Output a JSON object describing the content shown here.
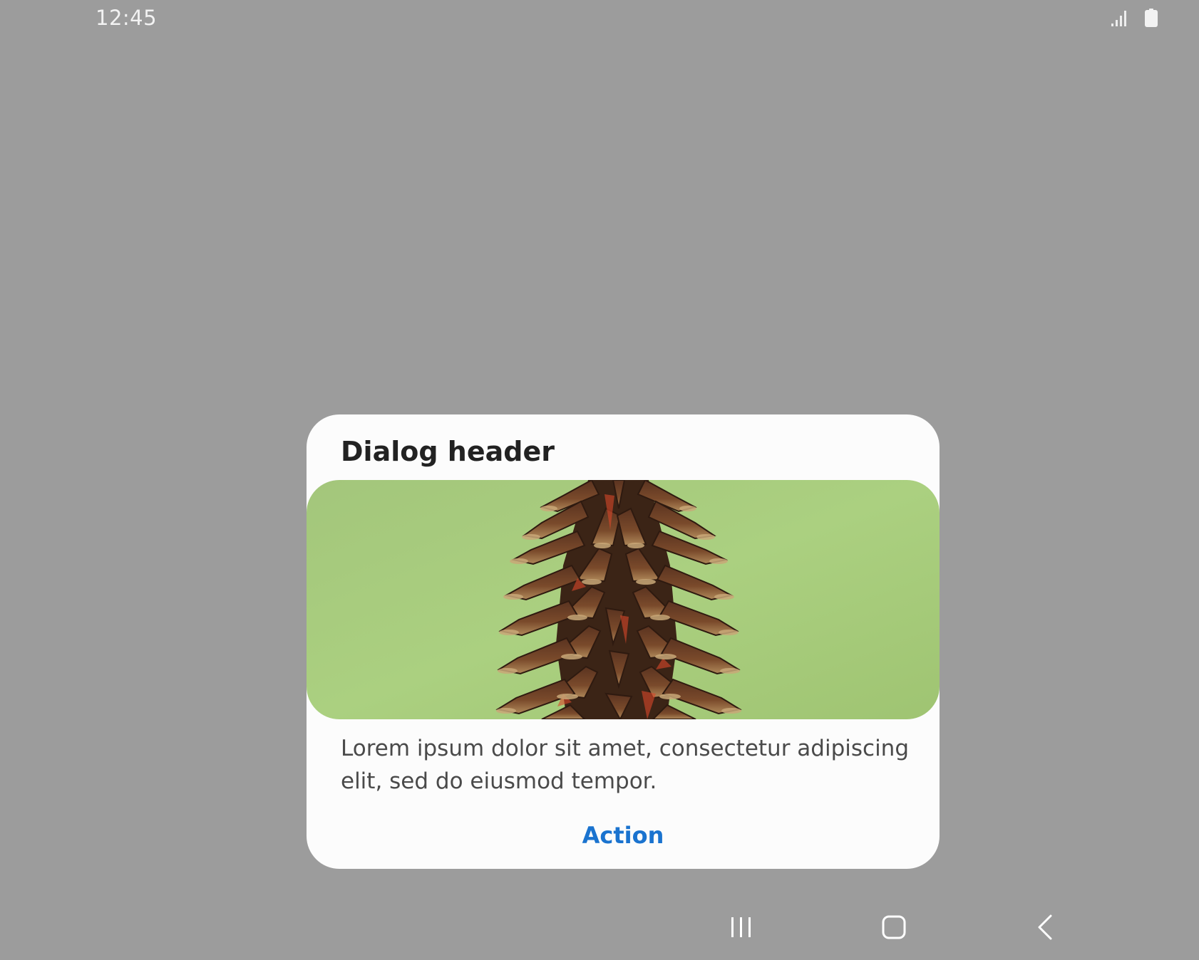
{
  "status_bar": {
    "time": "12:45",
    "icons": [
      "signal-icon",
      "battery-icon"
    ]
  },
  "dialog": {
    "title": "Dialog header",
    "image": "pinecone-on-green-background",
    "body": "Lorem ipsum dolor sit amet, consectetur adipiscing elit, sed do eiusmod tempor.",
    "action_label": "Action"
  },
  "nav_bar": {
    "buttons": [
      "recent-apps-icon",
      "home-icon",
      "back-icon"
    ]
  },
  "colors": {
    "background": "#9c9c9c",
    "dialog_bg": "#fcfcfc",
    "accent": "#1a73cf",
    "image_bg": "#a6cb7c"
  }
}
